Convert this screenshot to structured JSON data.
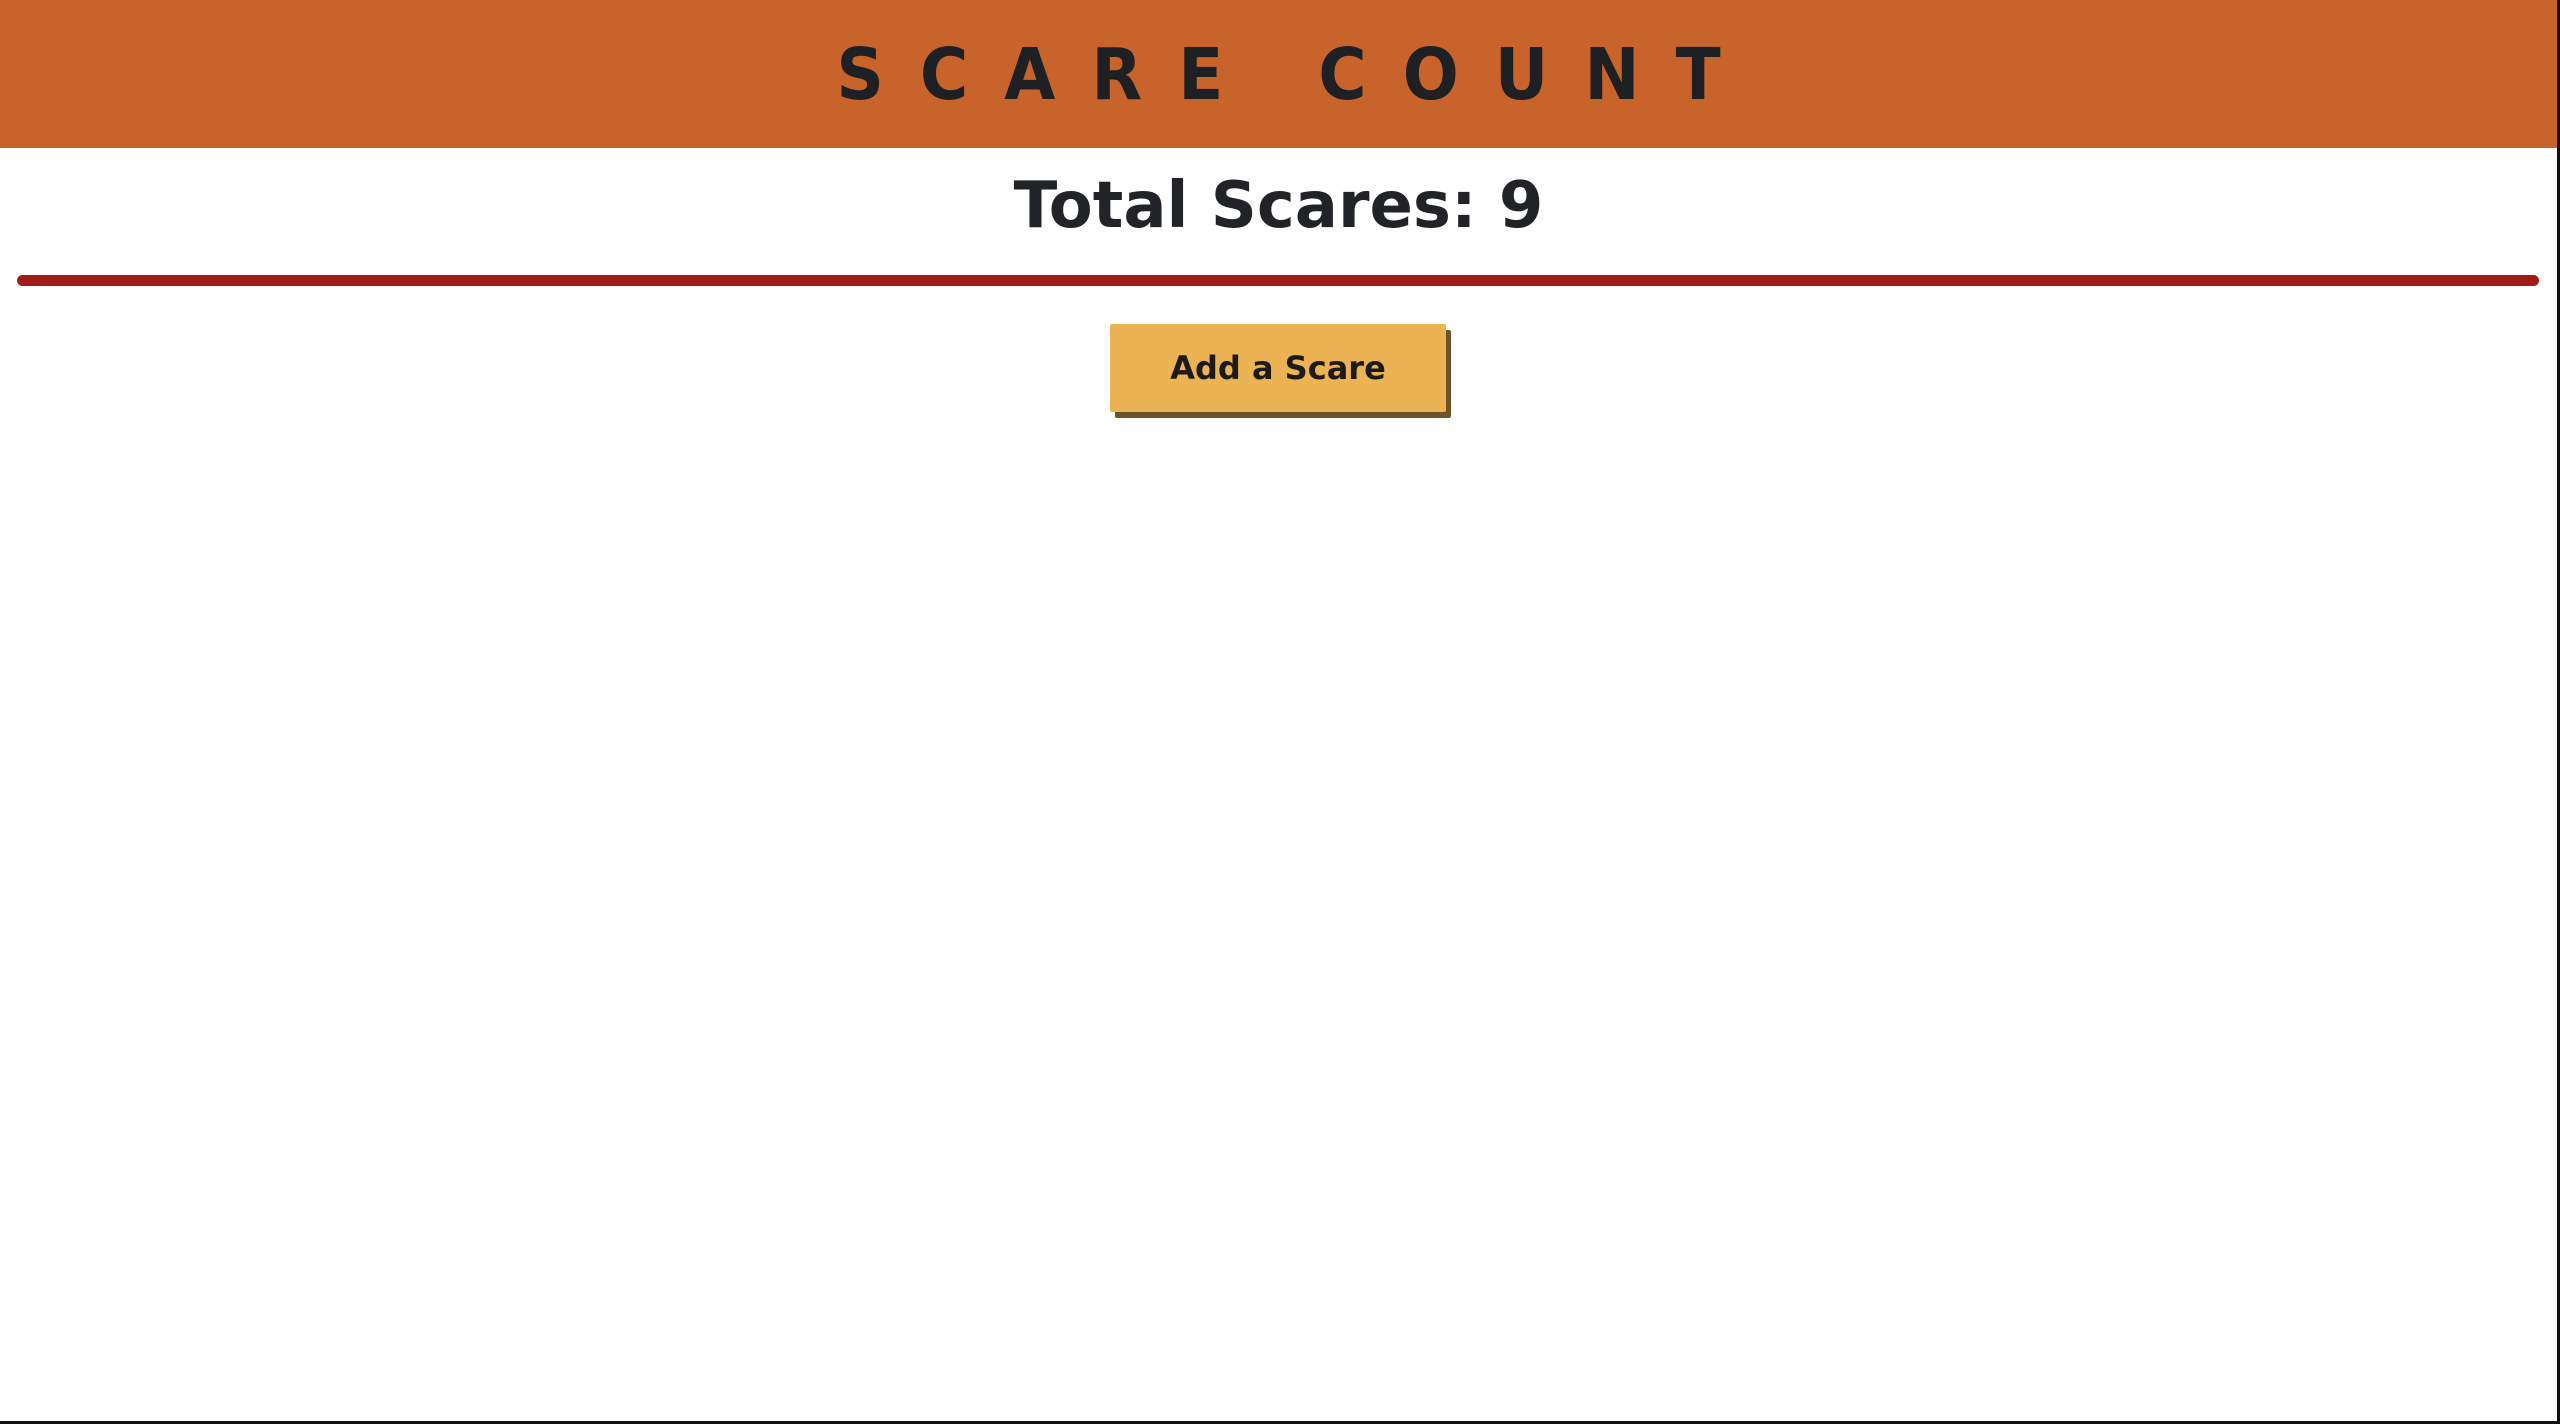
{
  "header": {
    "title": "Scare Count"
  },
  "counter": {
    "total_text": "Total Scares: 9",
    "total": 9
  },
  "actions": {
    "add_label": "Add a Scare"
  },
  "colors": {
    "header_bg": "#c8642b",
    "divider": "#a01d16",
    "button_bg": "#ebb354",
    "text": "#212327"
  }
}
